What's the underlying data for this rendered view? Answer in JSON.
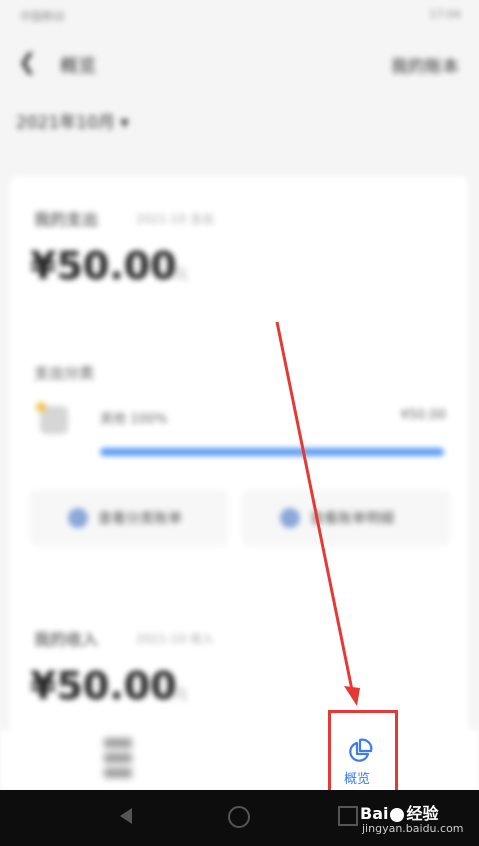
{
  "status_bar": {
    "left": "中国移动",
    "right": "17:04"
  },
  "header": {
    "back_icon": "chevron-left",
    "title": "概览",
    "right_link": "我的账本"
  },
  "month": "2021年10月 ▾",
  "expense_section": {
    "title": "我的支出",
    "subtitle": "2021-10 支出",
    "amount": "¥50.00",
    "unit": "元"
  },
  "category_section": {
    "title": "支出分类",
    "category_name": "其他 100%",
    "category_amount": "¥50.00",
    "percent": 100
  },
  "buttons": [
    {
      "label": "查看分类账单"
    },
    {
      "label": "查看账单明细"
    }
  ],
  "income_section": {
    "title": "我的收入",
    "subtitle": "2021-10 收入",
    "amount": "¥50.00",
    "unit": "元"
  },
  "tabbar": {
    "overview_label": "概览"
  },
  "watermark": {
    "logo_left": "Bai",
    "logo_right": "经验",
    "url": "jingyan.baidu.com"
  },
  "colors": {
    "accent": "#3d7de6",
    "highlight": "#e53935",
    "bar_fill": "#5b9bf3"
  }
}
